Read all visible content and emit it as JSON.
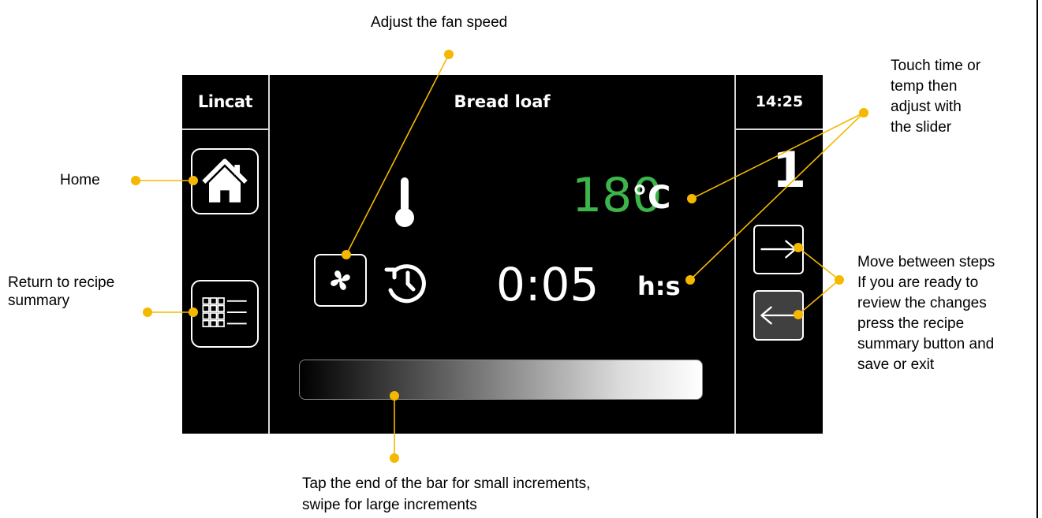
{
  "screen": {
    "brand": "Lincat",
    "title": "Bread loaf",
    "clock": "14:25",
    "step_number": "1",
    "temperature": {
      "value": "180",
      "unit": "°C"
    },
    "time": {
      "value": "0:05",
      "unit": "h:s"
    }
  },
  "icons": {
    "home": "home-icon",
    "summary": "recipe-summary-icon",
    "fan": "fan-icon",
    "thermometer": "thermometer-icon",
    "timer": "timer-icon",
    "next": "arrow-right-icon",
    "prev": "arrow-left-icon"
  },
  "annotations": {
    "fan": "Adjust the fan speed",
    "home": "Home",
    "summary_line1": "Return to recipe",
    "summary_line2": "summary",
    "touch_line1": "Touch time or",
    "touch_line2": "temp then",
    "touch_line3": "adjust with",
    "touch_line4": "the slider",
    "steps_line1": "Move between steps",
    "steps_line2": "If you are ready to",
    "steps_line3": "review the changes",
    "steps_line4": "press the recipe",
    "steps_line5": "summary button and",
    "steps_line6": "save or exit",
    "bar_line1": "Tap the end of the bar for small increments,",
    "bar_line2": "swipe for large increments"
  },
  "colors": {
    "screen_bg": "#000000",
    "temperature": "#3db54a",
    "callout": "#f5b800"
  }
}
